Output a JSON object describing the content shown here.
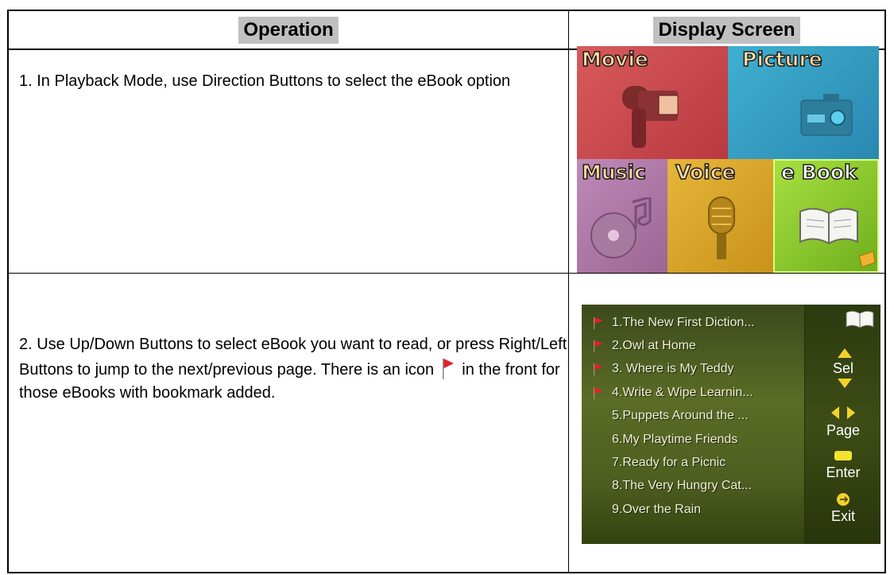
{
  "table": {
    "headers": {
      "operation": "Operation",
      "display_screen": "Display Screen"
    },
    "rows": [
      {
        "operation_text": "1. In Playback Mode, use Direction Buttons to select the eBook option"
      },
      {
        "operation_text_part1": "2. Use Up/Down Buttons to select eBook you want to read, or press Right/Left Buttons to jump to the next/previous page.   There is an icon",
        "operation_text_part2": "in the front for those eBooks with bookmark added."
      }
    ]
  },
  "playback_menu": {
    "tiles": [
      {
        "label": "Movie",
        "color": "#c84c50",
        "icon": "camcorder-icon"
      },
      {
        "label": "Picture",
        "color": "#2f9cc4",
        "icon": "camera-icon"
      },
      {
        "label": "Music",
        "color": "#b07aa8",
        "icon": "music-disc-icon"
      },
      {
        "label": "Voice",
        "color": "#d9a62a",
        "icon": "microphone-icon"
      },
      {
        "label": "e Book",
        "color": "#8ecb2c",
        "icon": "book-icon",
        "selected": true
      }
    ]
  },
  "ebook_list": {
    "items": [
      {
        "label": "1.The New First Diction...",
        "bookmarked": true
      },
      {
        "label": "2.Owl at Home",
        "bookmarked": true
      },
      {
        "label": "3. Where is My Teddy",
        "bookmarked": true
      },
      {
        "label": "4.Write & Wipe Learnin...",
        "bookmarked": true
      },
      {
        "label": "5.Puppets Around the ...",
        "bookmarked": false
      },
      {
        "label": "6.My Playtime Friends",
        "bookmarked": false
      },
      {
        "label": "7.Ready for a Picnic",
        "bookmarked": false
      },
      {
        "label": "8.The Very Hungry Cat...",
        "bookmarked": false
      },
      {
        "label": "9.Over the  Rain",
        "bookmarked": false
      }
    ],
    "sidebar": {
      "sel_label": "Sel",
      "page_label": "Page",
      "enter_label": "Enter",
      "exit_label": "Exit"
    }
  },
  "colors": {
    "header_bg": "#c0c0c0",
    "bookmark_flag": "#e0222a",
    "nav_arrow": "#f2d22a"
  }
}
